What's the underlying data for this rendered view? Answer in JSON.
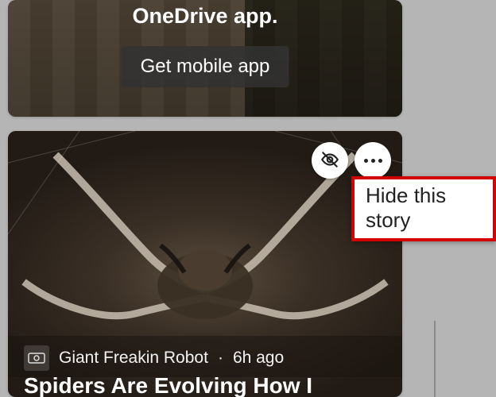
{
  "promo": {
    "title_line": "OneDrive app.",
    "button_label": "Get mobile app"
  },
  "story": {
    "actions": {
      "hide_icon": "hide",
      "more_icon": "more",
      "hide_tooltip": "Hide this story"
    },
    "source": {
      "name": "Giant Freakin Robot",
      "separator": "·",
      "timestamp": "6h ago"
    },
    "headline": "Spiders Are Evolving How I"
  }
}
